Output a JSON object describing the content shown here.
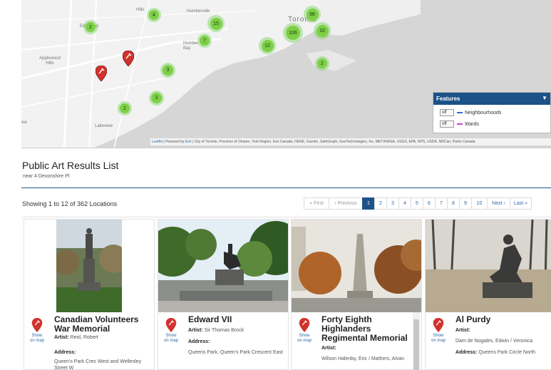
{
  "map": {
    "places": [
      "Hills",
      "Humberside",
      "Toronto",
      "Etobicoke",
      "Humber Bay",
      "Applewood Hills",
      "Lakeview",
      "ew"
    ],
    "clusters": [
      "4",
      "15",
      "98",
      "2",
      "106",
      "10",
      "7",
      "12",
      "3",
      "2",
      "3",
      "2"
    ],
    "features": {
      "title": "Features",
      "items": [
        {
          "toggle": "off",
          "label": "Neighbourhoods",
          "color": "#2f6bd8"
        },
        {
          "toggle": "off",
          "label": "Wards",
          "color": "#d23ad6"
        }
      ]
    },
    "attribution": {
      "leaflet": "Leaflet",
      "powered": " | Powered by ",
      "esri": "Esri",
      "rest": " | City of Toronto, Province of Ontario, York Region, Esri Canada, HERE, Garmin, SafeGraph, GeoTechnologies, Inc, METI/NASA, USGS, EPA, NPS, USDA, NRCan, Parks Canada"
    }
  },
  "results": {
    "title": "Public Art Results List",
    "near": "near 4 Devonshire Pl",
    "showing": "Showing 1 to 12 of 362 Locations"
  },
  "pager": {
    "first": "« First",
    "previous": "‹ Previous",
    "pages": [
      "1",
      "2",
      "3",
      "4",
      "5",
      "6",
      "7",
      "8",
      "9",
      "10"
    ],
    "next": "Next ›",
    "last": "Last »"
  },
  "cards": [
    {
      "show": "Show",
      "on": "on map",
      "title": "Canadian Volunteers War Memorial",
      "artist_label": "Artist:",
      "artist": "Reid, Robert",
      "address_label": "Address:",
      "address": "Queen's Park Cres West and Wellesley Street W"
    },
    {
      "show": "Show",
      "on": "on map",
      "title": "Edward VII",
      "artist_label": "Artist:",
      "artist": "Sir Thomas Brock",
      "address_label": "Address:",
      "address": "Queens Park, Queen's Park Crescent East"
    },
    {
      "show": "Show",
      "on": "on map",
      "title": "Forty Eighth Highlanders Regimental Memorial",
      "artist_label": "Artist:",
      "artist": "Wilson Halenby, Eric / Mathers, Alvan"
    },
    {
      "show": "Show",
      "on": "on map",
      "title": "Al Purdy",
      "artist_label": "Artist:",
      "artist": "Dam de Nogales, Edwin / Veronica",
      "address_label": "Address:",
      "address": "Queens Park Circle North"
    }
  ],
  "colors": {
    "accent": "#1d5287",
    "cluster": "#7dcf45",
    "pin": "#d2322d"
  }
}
